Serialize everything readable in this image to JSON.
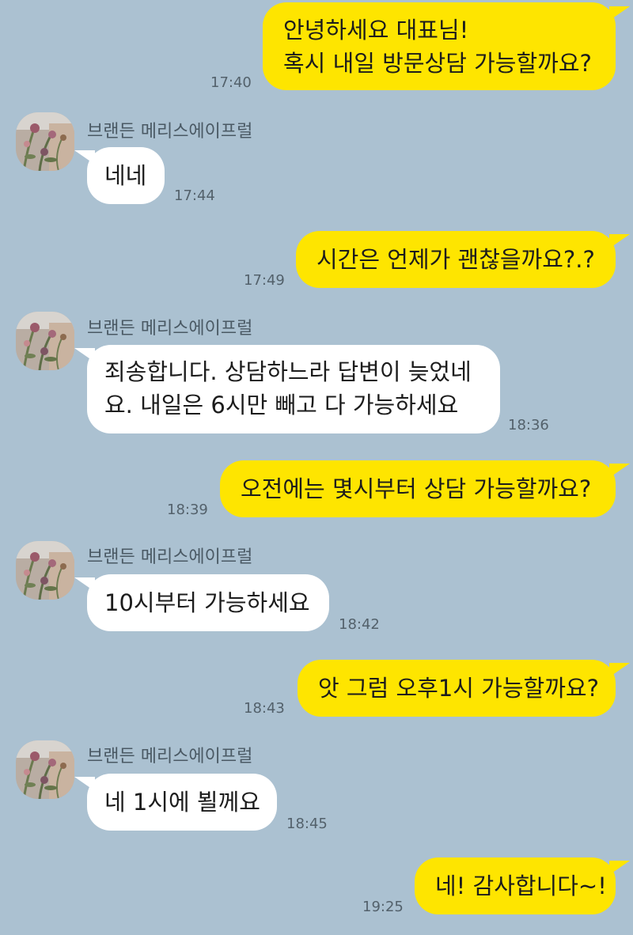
{
  "contact": {
    "name": "브랜든 메리스에이프럴",
    "avatar_icon": "flower-photo-avatar-icon"
  },
  "colors": {
    "background": "#abc1d1",
    "my_bubble": "#fee500",
    "their_bubble": "#ffffff",
    "text": "#1c1c1c",
    "time_text": "#53616b"
  },
  "messages": [
    {
      "from": "me",
      "lines": [
        "안녕하세요 대표님!",
        "혹시 내일 방문상담 가능할까요?"
      ],
      "time": "17:40"
    },
    {
      "from": "them",
      "sender": "브랜든 메리스에이프럴",
      "lines": [
        "네네"
      ],
      "time": "17:44"
    },
    {
      "from": "me",
      "lines": [
        "시간은 언제가 괜찮을까요?.?"
      ],
      "time": "17:49"
    },
    {
      "from": "them",
      "sender": "브랜든 메리스에이프럴",
      "lines": [
        "죄송합니다. 상담하느라 답변이 늦었네",
        "요. 내일은 6시만 빼고 다 가능하세요"
      ],
      "time": "18:36"
    },
    {
      "from": "me",
      "lines": [
        "오전에는 몇시부터 상담 가능할까요?"
      ],
      "time": "18:39"
    },
    {
      "from": "them",
      "sender": "브랜든 메리스에이프럴",
      "lines": [
        "10시부터 가능하세요"
      ],
      "time": "18:42"
    },
    {
      "from": "me",
      "lines": [
        "앗 그럼 오후1시 가능할까요?"
      ],
      "time": "18:43"
    },
    {
      "from": "them",
      "sender": "브랜든 메리스에이프럴",
      "lines": [
        "네 1시에 뵐께요"
      ],
      "time": "18:45"
    },
    {
      "from": "me",
      "lines": [
        "네! 감사합니다~!"
      ],
      "time": "19:25"
    }
  ]
}
